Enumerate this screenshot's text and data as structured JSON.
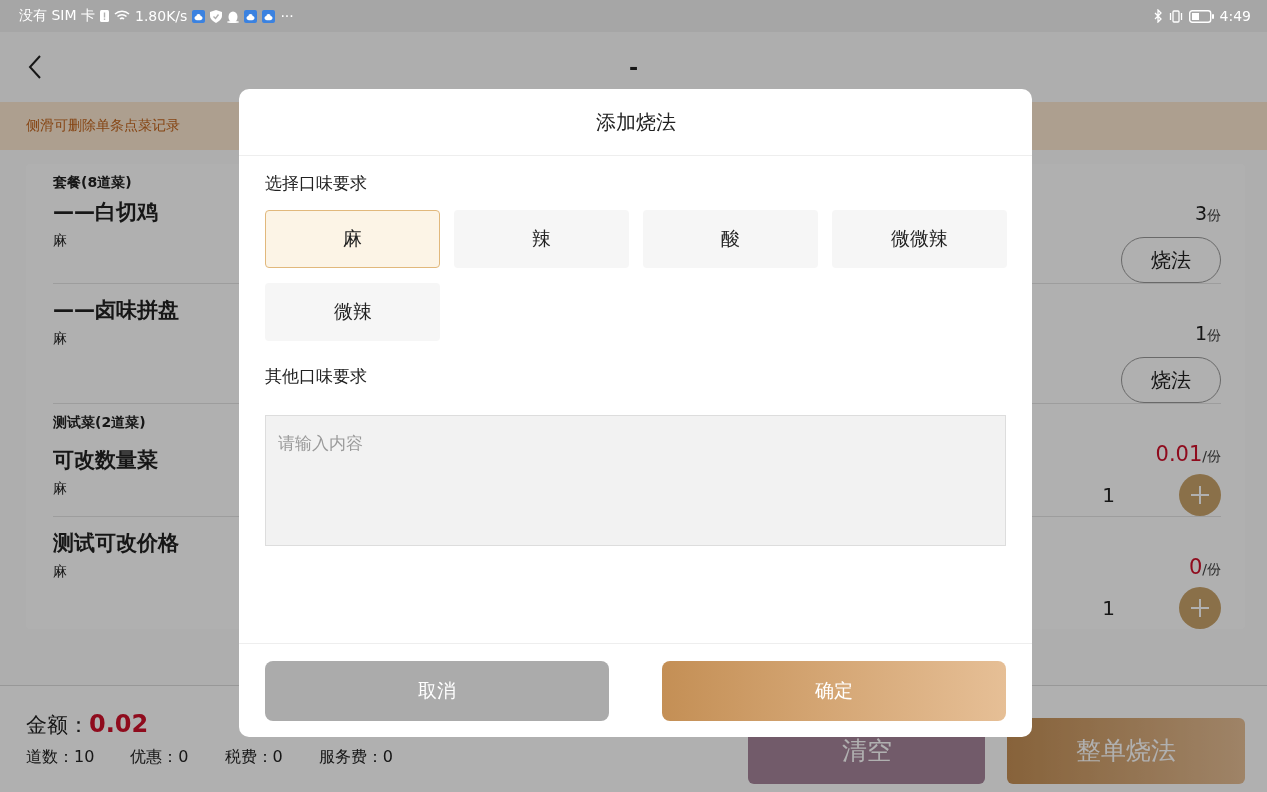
{
  "status_bar": {
    "carrier": "没有 SIM 卡",
    "speed": "1.80K/s",
    "overflow": "···",
    "time": "4:49"
  },
  "header": {
    "title": "-"
  },
  "notice": "侧滑可删除单条点菜记录",
  "groups": [
    {
      "title": "套餐(8道菜)",
      "items": [
        {
          "kind": "portion",
          "name": "——白切鸡",
          "note": "麻",
          "quantity": "3",
          "unit": "份",
          "button": "烧法"
        },
        {
          "kind": "portion",
          "name": "——卤味拼盘",
          "note": "麻",
          "quantity": "1",
          "unit": "份",
          "button": "烧法"
        }
      ]
    },
    {
      "title": "测试菜(2道菜)",
      "items": [
        {
          "kind": "priced",
          "name": "可改数量菜",
          "note": "麻",
          "price": "0.01",
          "unit": "/份",
          "count": "1"
        },
        {
          "kind": "priced",
          "name": "测试可改价格",
          "note": "麻",
          "price": "0",
          "unit": "/份",
          "count": "1"
        }
      ]
    }
  ],
  "summary": {
    "amount_label": "金额：",
    "amount": "0.02",
    "stats": [
      "道数：10",
      "优惠：0",
      "税费：0",
      "服务费：0"
    ]
  },
  "actions": {
    "clear": "清空",
    "whole_order": "整单烧法"
  },
  "dialog": {
    "title": "添加烧法",
    "taste_label": "选择口味要求",
    "options": [
      {
        "label": "麻",
        "selected": true
      },
      {
        "label": "辣",
        "selected": false
      },
      {
        "label": "酸",
        "selected": false
      },
      {
        "label": "微微辣",
        "selected": false
      },
      {
        "label": "微辣",
        "selected": false
      }
    ],
    "other_label": "其他口味要求",
    "placeholder": "请输入内容",
    "cancel": "取消",
    "confirm": "确定"
  }
}
